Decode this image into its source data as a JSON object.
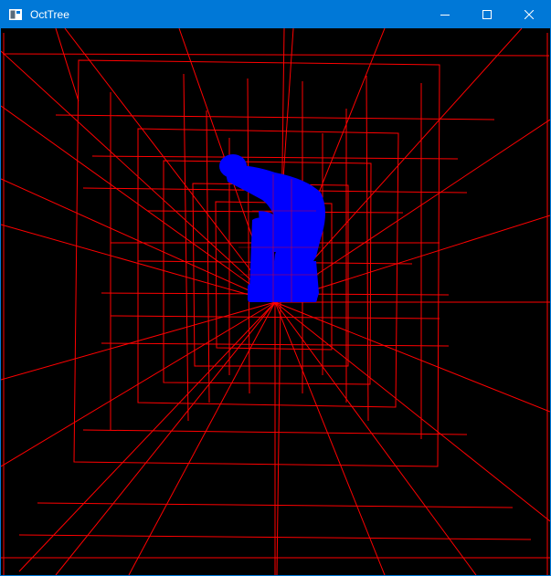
{
  "window": {
    "title": "OctTree",
    "icons": {
      "app": "app-window-icon",
      "minimize": "minimize-icon",
      "maximize": "maximize-icon",
      "close": "close-icon"
    }
  },
  "scene": {
    "background_color": "#000000",
    "wire_color": "#ff0000",
    "model_color": "#0000ff",
    "titlebar_color": "#0078d7"
  }
}
